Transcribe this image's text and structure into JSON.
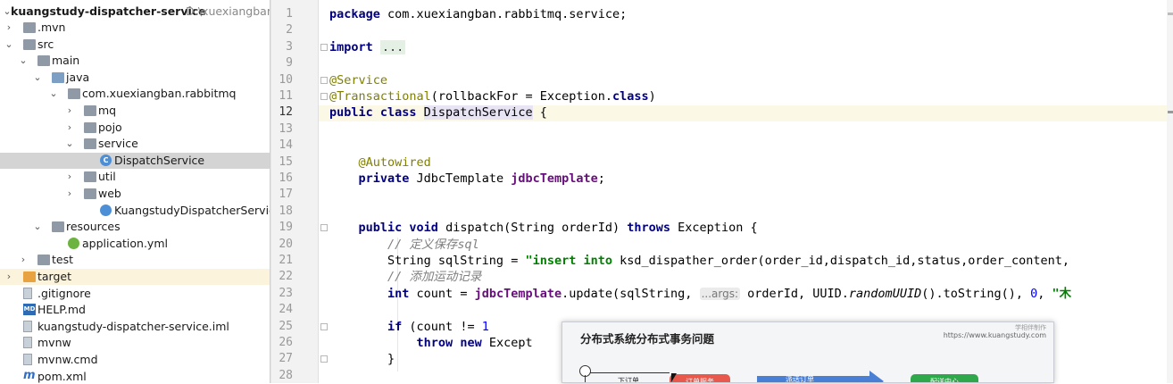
{
  "project_tree": {
    "root": {
      "name": "kuangstudy-dispatcher-service",
      "path": "D:\\xuexiangban\\c"
    },
    "items": [
      {
        "label": ".mvn",
        "icon": "folder-icon",
        "arrow": "collapsed"
      },
      {
        "label": "src",
        "icon": "folder-icon",
        "arrow": "expanded"
      },
      {
        "label": "main",
        "icon": "folder-icon",
        "arrow": "expanded"
      },
      {
        "label": "java",
        "icon": "source-folder-icon",
        "arrow": "expanded"
      },
      {
        "label": "com.xuexiangban.rabbitmq",
        "icon": "package-icon",
        "arrow": "expanded"
      },
      {
        "label": "mq",
        "icon": "package-icon",
        "arrow": "collapsed"
      },
      {
        "label": "pojo",
        "icon": "package-icon",
        "arrow": "collapsed"
      },
      {
        "label": "service",
        "icon": "package-icon",
        "arrow": "expanded"
      },
      {
        "label": "DispatchService",
        "icon": "class-icon",
        "arrow": "none",
        "selected": true
      },
      {
        "label": "util",
        "icon": "package-icon",
        "arrow": "collapsed"
      },
      {
        "label": "web",
        "icon": "package-icon",
        "arrow": "collapsed"
      },
      {
        "label": "KuangstudyDispatcherServiceApplic",
        "icon": "spring-boot-icon",
        "arrow": "none"
      },
      {
        "label": "resources",
        "icon": "resources-folder-icon",
        "arrow": "expanded"
      },
      {
        "label": "application.yml",
        "icon": "spring-config-icon",
        "arrow": "none"
      },
      {
        "label": "test",
        "icon": "folder-icon",
        "arrow": "collapsed"
      },
      {
        "label": "target",
        "icon": "excluded-folder-icon",
        "arrow": "collapsed",
        "highlighted": true
      },
      {
        "label": ".gitignore",
        "icon": "file-icon",
        "arrow": "none"
      },
      {
        "label": "HELP.md",
        "icon": "markdown-icon",
        "arrow": "none"
      },
      {
        "label": "kuangstudy-dispatcher-service.iml",
        "icon": "file-icon",
        "arrow": "none"
      },
      {
        "label": "mvnw",
        "icon": "file-icon",
        "arrow": "none"
      },
      {
        "label": "mvnw.cmd",
        "icon": "file-icon",
        "arrow": "none"
      },
      {
        "label": "pom.xml",
        "icon": "maven-icon",
        "arrow": "none"
      }
    ]
  },
  "editor": {
    "current_line": "12",
    "lines": [
      {
        "n": "1",
        "tokens": [
          [
            "kw",
            "package "
          ],
          [
            "",
            "com.xuexiangban.rabbitmq.service;"
          ]
        ]
      },
      {
        "n": "2",
        "tokens": []
      },
      {
        "n": "3",
        "tokens": [
          [
            "kw",
            "import "
          ],
          [
            "folded",
            "..."
          ]
        ]
      },
      {
        "n": "9",
        "tokens": []
      },
      {
        "n": "10",
        "tokens": [
          [
            "ann",
            "@Service"
          ]
        ]
      },
      {
        "n": "11",
        "tokens": [
          [
            "ann",
            "@Transactional"
          ],
          [
            "",
            "(rollbackFor = Exception."
          ],
          [
            "kw",
            "class"
          ],
          [
            "",
            ")"
          ]
        ]
      },
      {
        "n": "12",
        "tokens": [
          [
            "kw",
            "public class "
          ],
          [
            "hl-class",
            "DispatchService"
          ],
          [
            "",
            " {"
          ]
        ]
      },
      {
        "n": "13",
        "tokens": []
      },
      {
        "n": "14",
        "tokens": []
      },
      {
        "n": "15",
        "tokens": [
          [
            "",
            "    "
          ],
          [
            "ann",
            "@Autowired"
          ]
        ]
      },
      {
        "n": "16",
        "tokens": [
          [
            "",
            "    "
          ],
          [
            "kw",
            "private "
          ],
          [
            "",
            "JdbcTemplate "
          ],
          [
            "fld",
            "jdbcTemplate"
          ],
          [
            "",
            ";"
          ]
        ]
      },
      {
        "n": "17",
        "tokens": []
      },
      {
        "n": "18",
        "tokens": []
      },
      {
        "n": "19",
        "tokens": [
          [
            "",
            "    "
          ],
          [
            "kw",
            "public void "
          ],
          [
            "",
            "dispatch(String orderId) "
          ],
          [
            "kw",
            "throws "
          ],
          [
            "",
            "Exception {"
          ]
        ]
      },
      {
        "n": "20",
        "tokens": [
          [
            "",
            "        "
          ],
          [
            "cmt",
            "// 定义保存sql"
          ]
        ]
      },
      {
        "n": "21",
        "tokens": [
          [
            "",
            "        String sqlString = "
          ],
          [
            "str",
            "\"insert into "
          ],
          [
            "",
            "ksd_dispather_order(order_id,dispatch_id,status,order_content,"
          ]
        ]
      },
      {
        "n": "22",
        "tokens": [
          [
            "",
            "        "
          ],
          [
            "cmt",
            "// 添加运动记录"
          ]
        ]
      },
      {
        "n": "23",
        "tokens": [
          [
            "",
            "        "
          ],
          [
            "kw",
            "int "
          ],
          [
            "",
            "count = "
          ],
          [
            "fld",
            "jdbcTemplate"
          ],
          [
            "",
            ".update(sqlString, "
          ],
          [
            "hint",
            "...args:"
          ],
          [
            "",
            " orderId, UUID."
          ],
          [
            "ital",
            "randomUUID"
          ],
          [
            "",
            "().toString(), "
          ],
          [
            "num",
            "0"
          ],
          [
            "",
            ", "
          ],
          [
            "str",
            "\"木"
          ]
        ]
      },
      {
        "n": "24",
        "tokens": []
      },
      {
        "n": "25",
        "tokens": [
          [
            "",
            "        "
          ],
          [
            "kw",
            "if "
          ],
          [
            "",
            "(count != "
          ],
          [
            "num",
            "1"
          ],
          [
            ") {"
          ]
        ]
      },
      {
        "n": "26",
        "tokens": [
          [
            "",
            "            "
          ],
          [
            "kw",
            "throw new "
          ],
          [
            "",
            "Except"
          ]
        ]
      },
      {
        "n": "27",
        "tokens": [
          [
            "",
            "        }"
          ]
        ]
      },
      {
        "n": "28",
        "tokens": []
      }
    ]
  },
  "slide": {
    "title": "分布式系统分布式事务问题",
    "url": "https://www.kuangstudy.com",
    "logo_text": "学相伴制作",
    "order_label": "下订单",
    "red_box": "订单服务",
    "arrow_label": "派送订单",
    "green_box": "配送中心"
  }
}
